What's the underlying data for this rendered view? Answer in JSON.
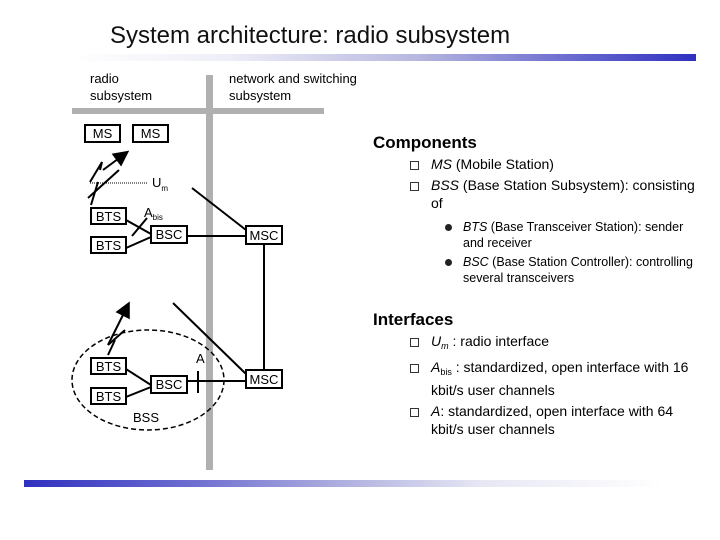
{
  "title": "System architecture: radio subsystem",
  "diagram": {
    "labels": {
      "radio_subsystem_line1": "radio",
      "radio_subsystem_line2": "subsystem",
      "network_line1": "network and switching",
      "network_line2": "subsystem"
    },
    "nodes": {
      "ms1": "MS",
      "ms2": "MS",
      "bts": "BTS",
      "bsc": "BSC",
      "msc": "MSC",
      "bss": "BSS"
    },
    "interfaces": {
      "um_main": "U",
      "um_sub": "m",
      "abis_main": "A",
      "abis_sub": "bis",
      "a": "A"
    }
  },
  "components": {
    "heading": "Components",
    "items": [
      {
        "em": "MS",
        "text": " (Mobile Station)"
      },
      {
        "em": "BSS",
        "text": " (Base Station Subsystem): consisting of"
      }
    ],
    "subitems": [
      {
        "em": "BTS",
        "text": " (Base Transceiver Station): sender and receiver"
      },
      {
        "em": "BSC",
        "text": " (Base Station Controller): controlling several transceivers"
      }
    ]
  },
  "interfaces": {
    "heading": "Interfaces",
    "items": [
      {
        "main": "U",
        "sub": "m",
        "text": " : radio interface"
      },
      {
        "main": "A",
        "sub": "bis",
        "text": " : standardized, open interface with 16 kbit/s user channels"
      },
      {
        "main": "A",
        "sub": "",
        "text": ": standardized, open interface with 64 kbit/s user channels"
      }
    ]
  },
  "colors": {
    "divider": "#b0b0b0",
    "accent_bar": "#3030c0"
  }
}
